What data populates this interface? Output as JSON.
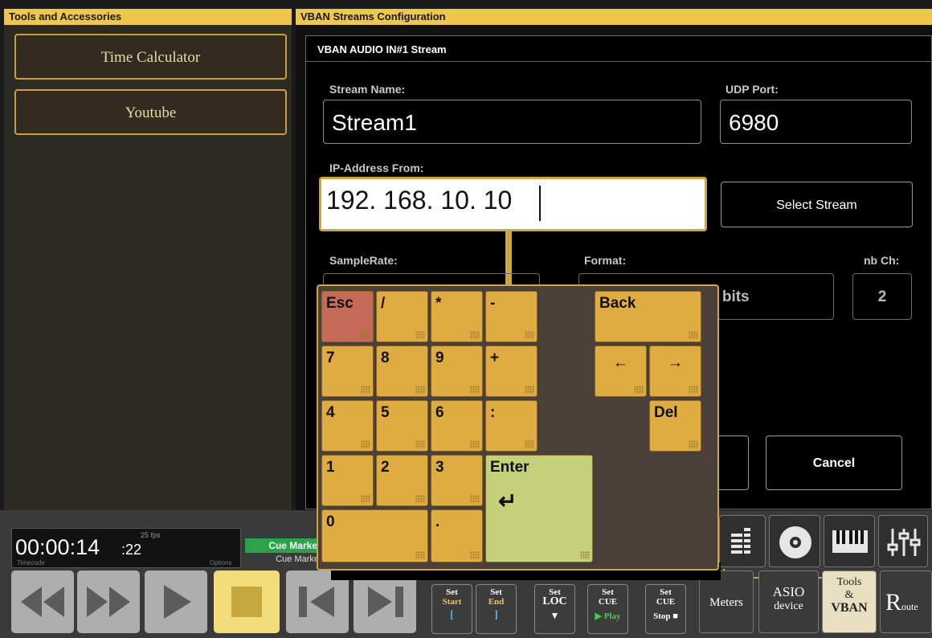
{
  "left_header": "Tools and Accessories",
  "right_header": "VBAN Streams Configuration",
  "tools": [
    "Time Calculator",
    "Youtube"
  ],
  "dialog": {
    "title": "VBAN AUDIO IN#1 Stream",
    "stream_name_label": "Stream Name:",
    "stream_name": "Stream1",
    "udp_port_label": "UDP Port:",
    "udp_port": "6980",
    "ip_label": "IP-Address From:",
    "ip_value": "192. 168. 10. 10",
    "select_stream": "Select Stream",
    "samplerate_label": "SampleRate:",
    "format_label": "Format:",
    "format_value": "6 bits",
    "nbch_label": "nb Ch:",
    "nbch_value": "2",
    "cancel": "Cancel"
  },
  "keypad": {
    "esc": "Esc",
    "slash": "/",
    "star": "*",
    "minus": "-",
    "back": "Back",
    "k7": "7",
    "k8": "8",
    "k9": "9",
    "plus": "+",
    "left": "←",
    "right": "→",
    "k4": "4",
    "k5": "5",
    "k6": "6",
    "colon": ":",
    "del": "Del",
    "k1": "1",
    "k2": "2",
    "k3": "3",
    "enter": "Enter",
    "enter_arrow": "↵",
    "k0": "0",
    "dot": "."
  },
  "timecode": {
    "value": "00:00:14",
    "frames": ":22",
    "fps": "25 fps",
    "label": "Timecode",
    "options": "Options"
  },
  "cue": {
    "header": "Cue Marke",
    "sub": "Cue Marke"
  },
  "set_buttons": [
    {
      "l1": "Set",
      "l2": "Start",
      "l3": "["
    },
    {
      "l1": "Set",
      "l2": "End",
      "l3": "]"
    },
    {
      "l1": "Set",
      "l2": "LOC",
      "l3": "▼"
    },
    {
      "l1": "Set",
      "l2": "CUE",
      "l3": "▶ Play"
    },
    {
      "l1": "Set",
      "l2": "CUE",
      "l3": "Stop ■"
    }
  ],
  "pages": {
    "meters": "Meters",
    "asio_1": "ASIO",
    "asio_2": "device",
    "tools_1": "Tools",
    "tools_2": "&",
    "tools_3": "VBAN",
    "route": "R",
    "route_small": "oute"
  },
  "icons": [
    "meter-icon",
    "disc-icon",
    "keyboard-icon",
    "mixer-icon"
  ],
  "colors": {
    "accent": "#f0c54b",
    "key": "#dfac42",
    "esc": "#c46a56",
    "enter": "#c5d07a",
    "cue_green": "#2aa34a"
  }
}
